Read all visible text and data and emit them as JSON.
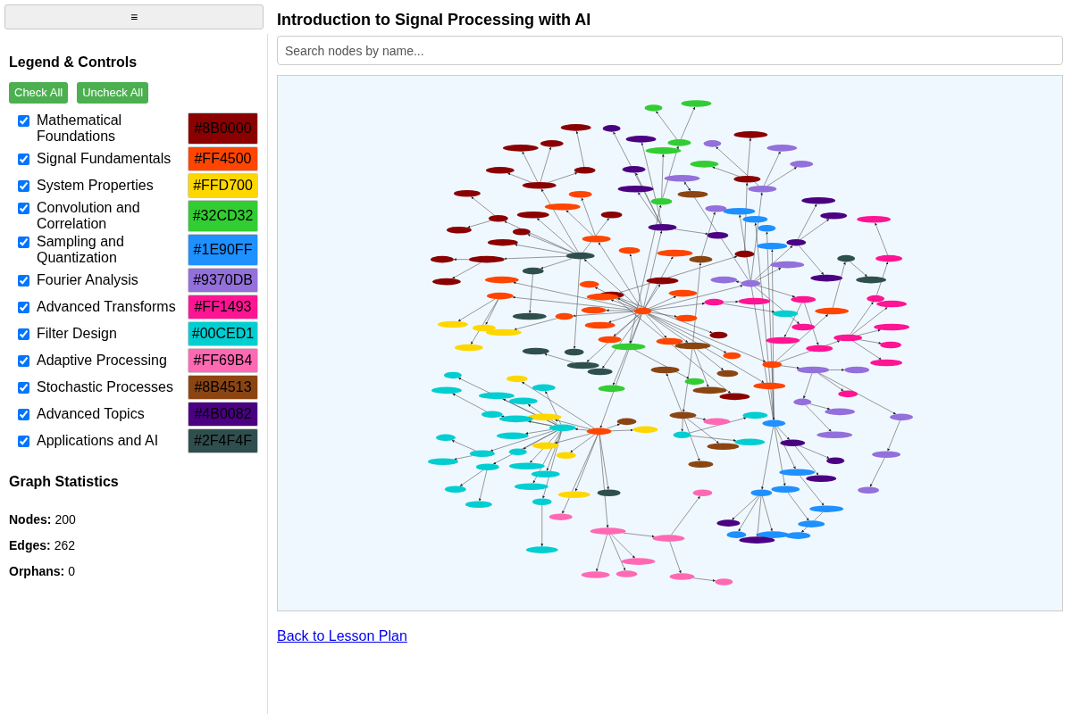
{
  "menu_button": {
    "label": "≡"
  },
  "title": "Introduction to Signal Processing with AI",
  "legend": {
    "heading": "Legend & Controls",
    "buttons": [
      "Check All",
      "Uncheck All"
    ],
    "items": [
      {
        "label": "Mathematical Foundations",
        "checked": true,
        "color": "#8b0000",
        "code": "#8B0000"
      },
      {
        "label": "Signal Fundamentals",
        "checked": true,
        "color": "#ff4500",
        "code": "#FF4500"
      },
      {
        "label": "System Properties",
        "checked": true,
        "color": "#ffd700",
        "code": "#FFD700"
      },
      {
        "label": "Convolution and Correlation",
        "checked": true,
        "color": "#32cd32",
        "code": "#32CD32"
      },
      {
        "label": "Sampling and Quantization",
        "checked": true,
        "color": "#1e90ff",
        "code": "#1E90FF"
      },
      {
        "label": "Fourier Analysis",
        "checked": true,
        "color": "#9370db",
        "code": "#9370DB"
      },
      {
        "label": "Advanced Transforms",
        "checked": true,
        "color": "#ff1493",
        "code": "#FF1493"
      },
      {
        "label": "Filter Design",
        "checked": true,
        "color": "#00ced1",
        "code": "#00CED1"
      },
      {
        "label": "Adaptive Processing",
        "checked": true,
        "color": "#ff69b4",
        "code": "#FF69B4"
      },
      {
        "label": "Stochastic Processes",
        "checked": true,
        "color": "#8b4513",
        "code": "#8B4513"
      },
      {
        "label": "Advanced Topics",
        "checked": true,
        "color": "#4b0082",
        "code": "#4B0082"
      },
      {
        "label": "Applications and AI",
        "checked": true,
        "color": "#2f4f4f",
        "code": "#2F4F4F"
      }
    ]
  },
  "statistics": {
    "heading": "Graph Statistics",
    "rows": [
      {
        "label": "Nodes:",
        "value": "200"
      },
      {
        "label": "Edges:",
        "value": "262"
      },
      {
        "label": "Orphans:",
        "value": "0"
      }
    ]
  },
  "search": {
    "placeholder": "Search nodes by name..."
  },
  "back_link": "Back to Lesson Plan"
}
